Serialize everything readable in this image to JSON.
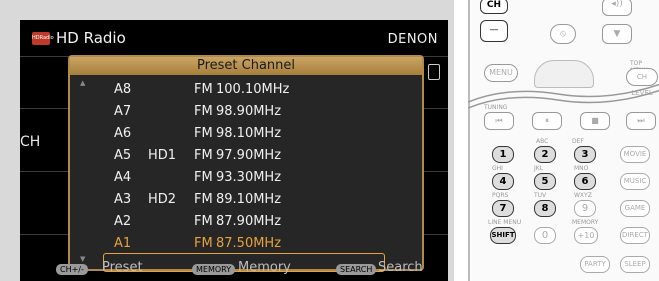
{
  "tv": {
    "hd_logo_text": "HDRadio",
    "title": "HD Radio",
    "brand": "DENON",
    "side_label": "CH"
  },
  "popup": {
    "title": "Preset Channel",
    "scroll_up": "▲",
    "scroll_down": "▼",
    "presets": [
      {
        "preset": "A8",
        "hd": "",
        "band": "FM",
        "freq": "100.10MHz",
        "selected": false
      },
      {
        "preset": "A7",
        "hd": "",
        "band": "FM",
        "freq": "98.90MHz",
        "selected": false
      },
      {
        "preset": "A6",
        "hd": "",
        "band": "FM",
        "freq": "98.10MHz",
        "selected": false
      },
      {
        "preset": "A5",
        "hd": "HD1",
        "band": "FM",
        "freq": "97.90MHz",
        "selected": false
      },
      {
        "preset": "A4",
        "hd": "",
        "band": "FM",
        "freq": "93.30MHz",
        "selected": false
      },
      {
        "preset": "A3",
        "hd": "HD2",
        "band": "FM",
        "freq": "89.10MHz",
        "selected": false
      },
      {
        "preset": "A2",
        "hd": "",
        "band": "FM",
        "freq": "87.90MHz",
        "selected": false
      },
      {
        "preset": "A1",
        "hd": "",
        "band": "FM",
        "freq": "87.50MHz",
        "selected": true
      }
    ]
  },
  "footer": {
    "ch_key": "CH+/-",
    "preset_label": "Preset",
    "memory_key": "MEMORY",
    "memory_label": "Memory",
    "search_key": "SEARCH",
    "search_label": "Search"
  },
  "remote": {
    "ch": "CH",
    "minus": "—",
    "menu": "MENU",
    "top_menu": "TOP MENU",
    "ch_level": "CH LEVEL",
    "tuning": "TUNING",
    "keys": [
      "1",
      "2",
      "3",
      "4",
      "5",
      "6",
      "7",
      "8",
      "9",
      "0",
      "+10"
    ],
    "key_letters": [
      "ABC",
      "DEF",
      "GHI",
      "JKL",
      "MNO",
      "PQRS",
      "TUV",
      "WXYZ"
    ],
    "shift": "SHIFT",
    "movie": "MOVIE",
    "music": "MUSIC",
    "game": "GAME",
    "direct": "DIRECT",
    "party": "PARTY",
    "sleep": "SLEEP",
    "line_menu": "LINE MENU",
    "memory": "MEMORY"
  },
  "colors": {
    "accent": "#e6a23c",
    "popup_border": "#b08a4c"
  }
}
